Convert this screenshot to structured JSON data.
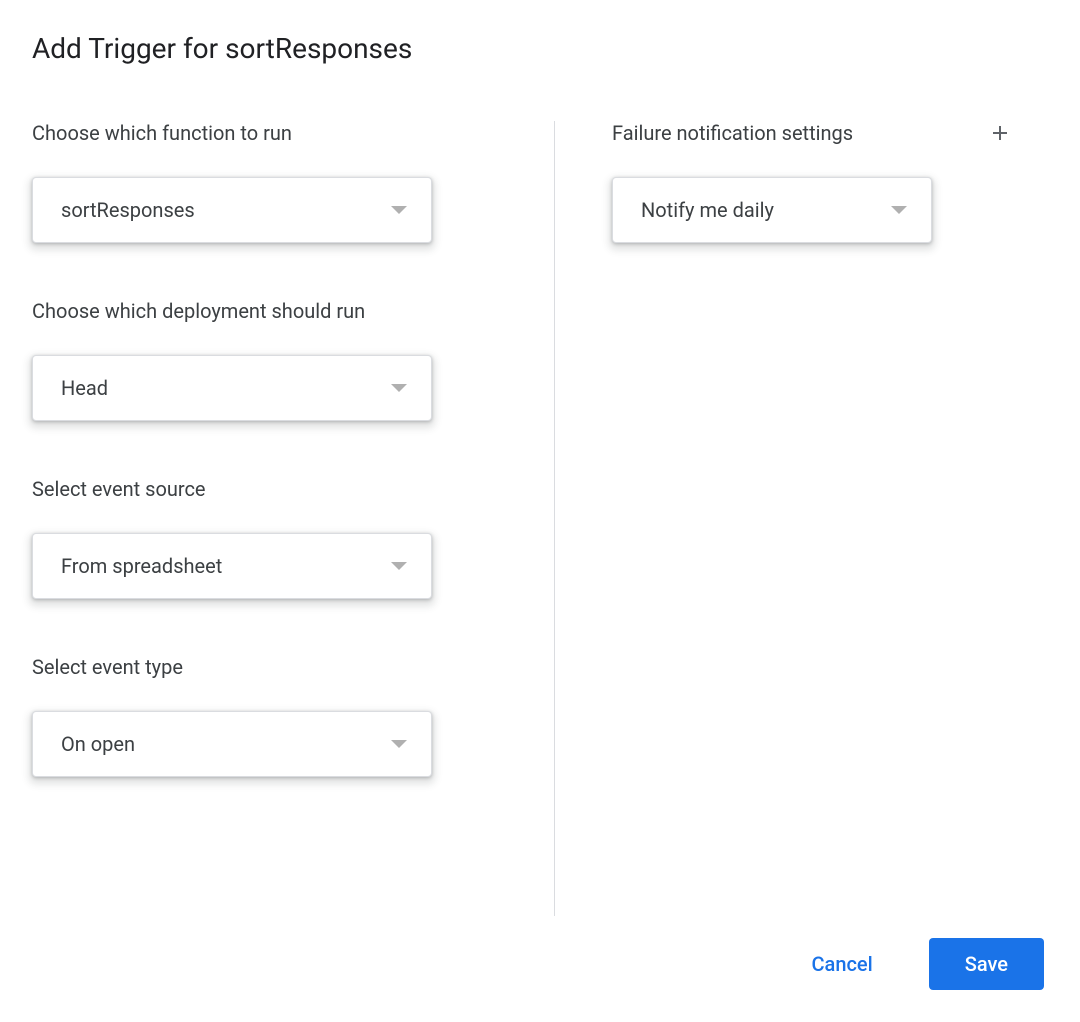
{
  "dialog": {
    "title": "Add Trigger for sortResponses"
  },
  "left": {
    "function": {
      "label": "Choose which function to run",
      "value": "sortResponses"
    },
    "deployment": {
      "label": "Choose which deployment should run",
      "value": "Head"
    },
    "eventSource": {
      "label": "Select event source",
      "value": "From spreadsheet"
    },
    "eventType": {
      "label": "Select event type",
      "value": "On open"
    }
  },
  "right": {
    "notification": {
      "label": "Failure notification settings",
      "value": "Notify me daily"
    }
  },
  "footer": {
    "cancel": "Cancel",
    "save": "Save"
  }
}
